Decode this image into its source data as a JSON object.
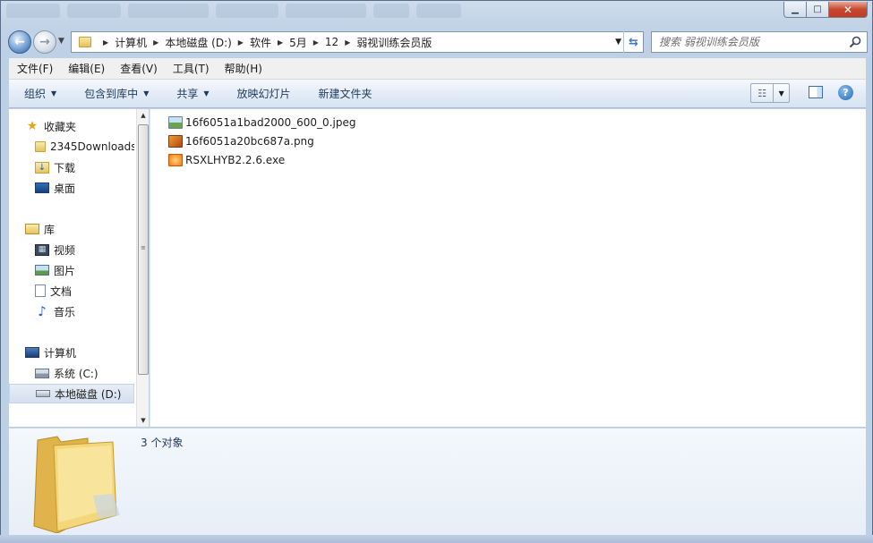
{
  "window": {
    "minimize_label": "▁",
    "maximize_label": "□",
    "close_label": "✕"
  },
  "address": {
    "crumbs": [
      "计算机",
      "本地磁盘 (D:)",
      "软件",
      "5月",
      "12",
      "弱视训练会员版"
    ]
  },
  "search": {
    "placeholder": "搜索 弱视训练会员版"
  },
  "menu": [
    "文件(F)",
    "编辑(E)",
    "查看(V)",
    "工具(T)",
    "帮助(H)"
  ],
  "commands": {
    "organize": "组织",
    "include_library": "包含到库中",
    "share": "共享",
    "slideshow": "放映幻灯片",
    "new_folder": "新建文件夹"
  },
  "nav": {
    "favorites": "收藏夹",
    "fav_items": [
      "2345Downloads",
      "下载",
      "桌面"
    ],
    "libraries": "库",
    "lib_items": [
      "视频",
      "图片",
      "文档",
      "音乐"
    ],
    "computer": "计算机",
    "drives": [
      "系统 (C:)",
      "本地磁盘 (D:)"
    ],
    "selected": "本地磁盘 (D:)"
  },
  "files": [
    {
      "name": "16f6051a1bad2000_600_0.jpeg",
      "icon": "jpeg-image-icon"
    },
    {
      "name": "16f6051a20bc687a.png",
      "icon": "png-image-icon"
    },
    {
      "name": "RSXLHYB2.2.6.exe",
      "icon": "exe-app-icon"
    }
  ],
  "details": {
    "count": "3 个对象"
  }
}
